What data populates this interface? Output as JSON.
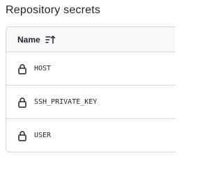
{
  "section": {
    "title": "Repository secrets"
  },
  "table": {
    "header": {
      "name_label": "Name",
      "sort_icon": "sort-ascending-icon"
    },
    "rows": [
      {
        "name": "HOST",
        "icon": "lock-icon"
      },
      {
        "name": "SSH_PRIVATE_KEY",
        "icon": "lock-icon"
      },
      {
        "name": "USER",
        "icon": "lock-icon"
      }
    ]
  },
  "colors": {
    "text": "#1f2328",
    "border": "#d0d7de",
    "header_bg": "#f6f8fa"
  }
}
